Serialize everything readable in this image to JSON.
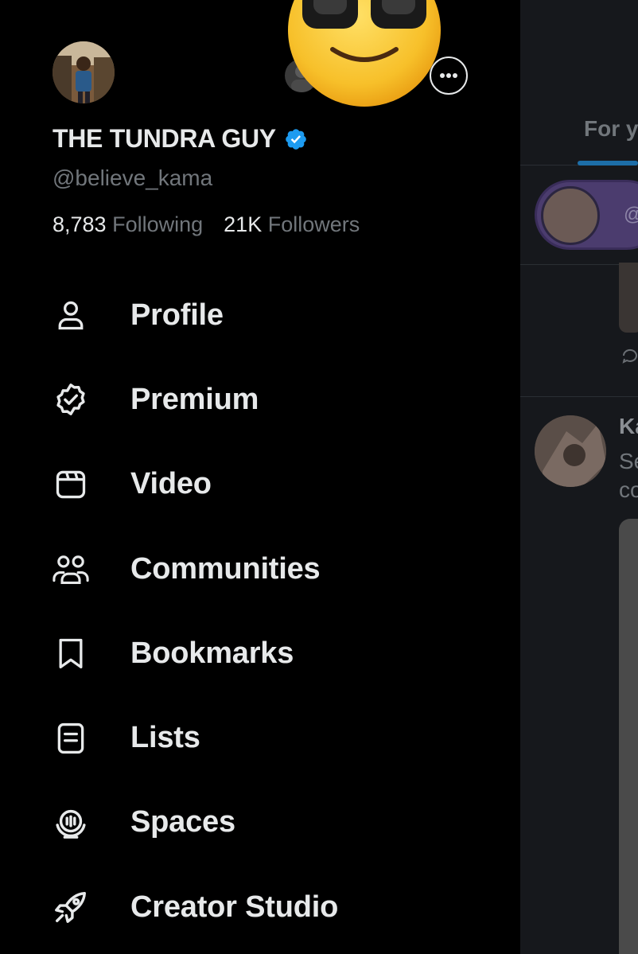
{
  "profile": {
    "name": "THE TUNDRA GUY",
    "handle": "@believe_kama",
    "following_count": "8,783",
    "following_label": "Following",
    "followers_count": "21K",
    "followers_label": "Followers"
  },
  "menu": {
    "items": [
      {
        "label": "Profile",
        "icon": "person-icon"
      },
      {
        "label": "Premium",
        "icon": "verified-badge-icon"
      },
      {
        "label": "Video",
        "icon": "video-icon"
      },
      {
        "label": "Communities",
        "icon": "communities-icon"
      },
      {
        "label": "Bookmarks",
        "icon": "bookmark-icon"
      },
      {
        "label": "Lists",
        "icon": "list-icon"
      },
      {
        "label": "Spaces",
        "icon": "spaces-icon"
      },
      {
        "label": "Creator Studio",
        "icon": "rocket-icon"
      }
    ]
  },
  "feed": {
    "tab_label": "For y",
    "pill_text": "@",
    "post_author": "Ka",
    "post_line1": "Se",
    "post_line2": "co"
  },
  "colors": {
    "background": "#000000",
    "text": "#e7e9ea",
    "muted": "#71767b",
    "verified": "#1d9bf0",
    "feed_bg": "#16181c"
  }
}
